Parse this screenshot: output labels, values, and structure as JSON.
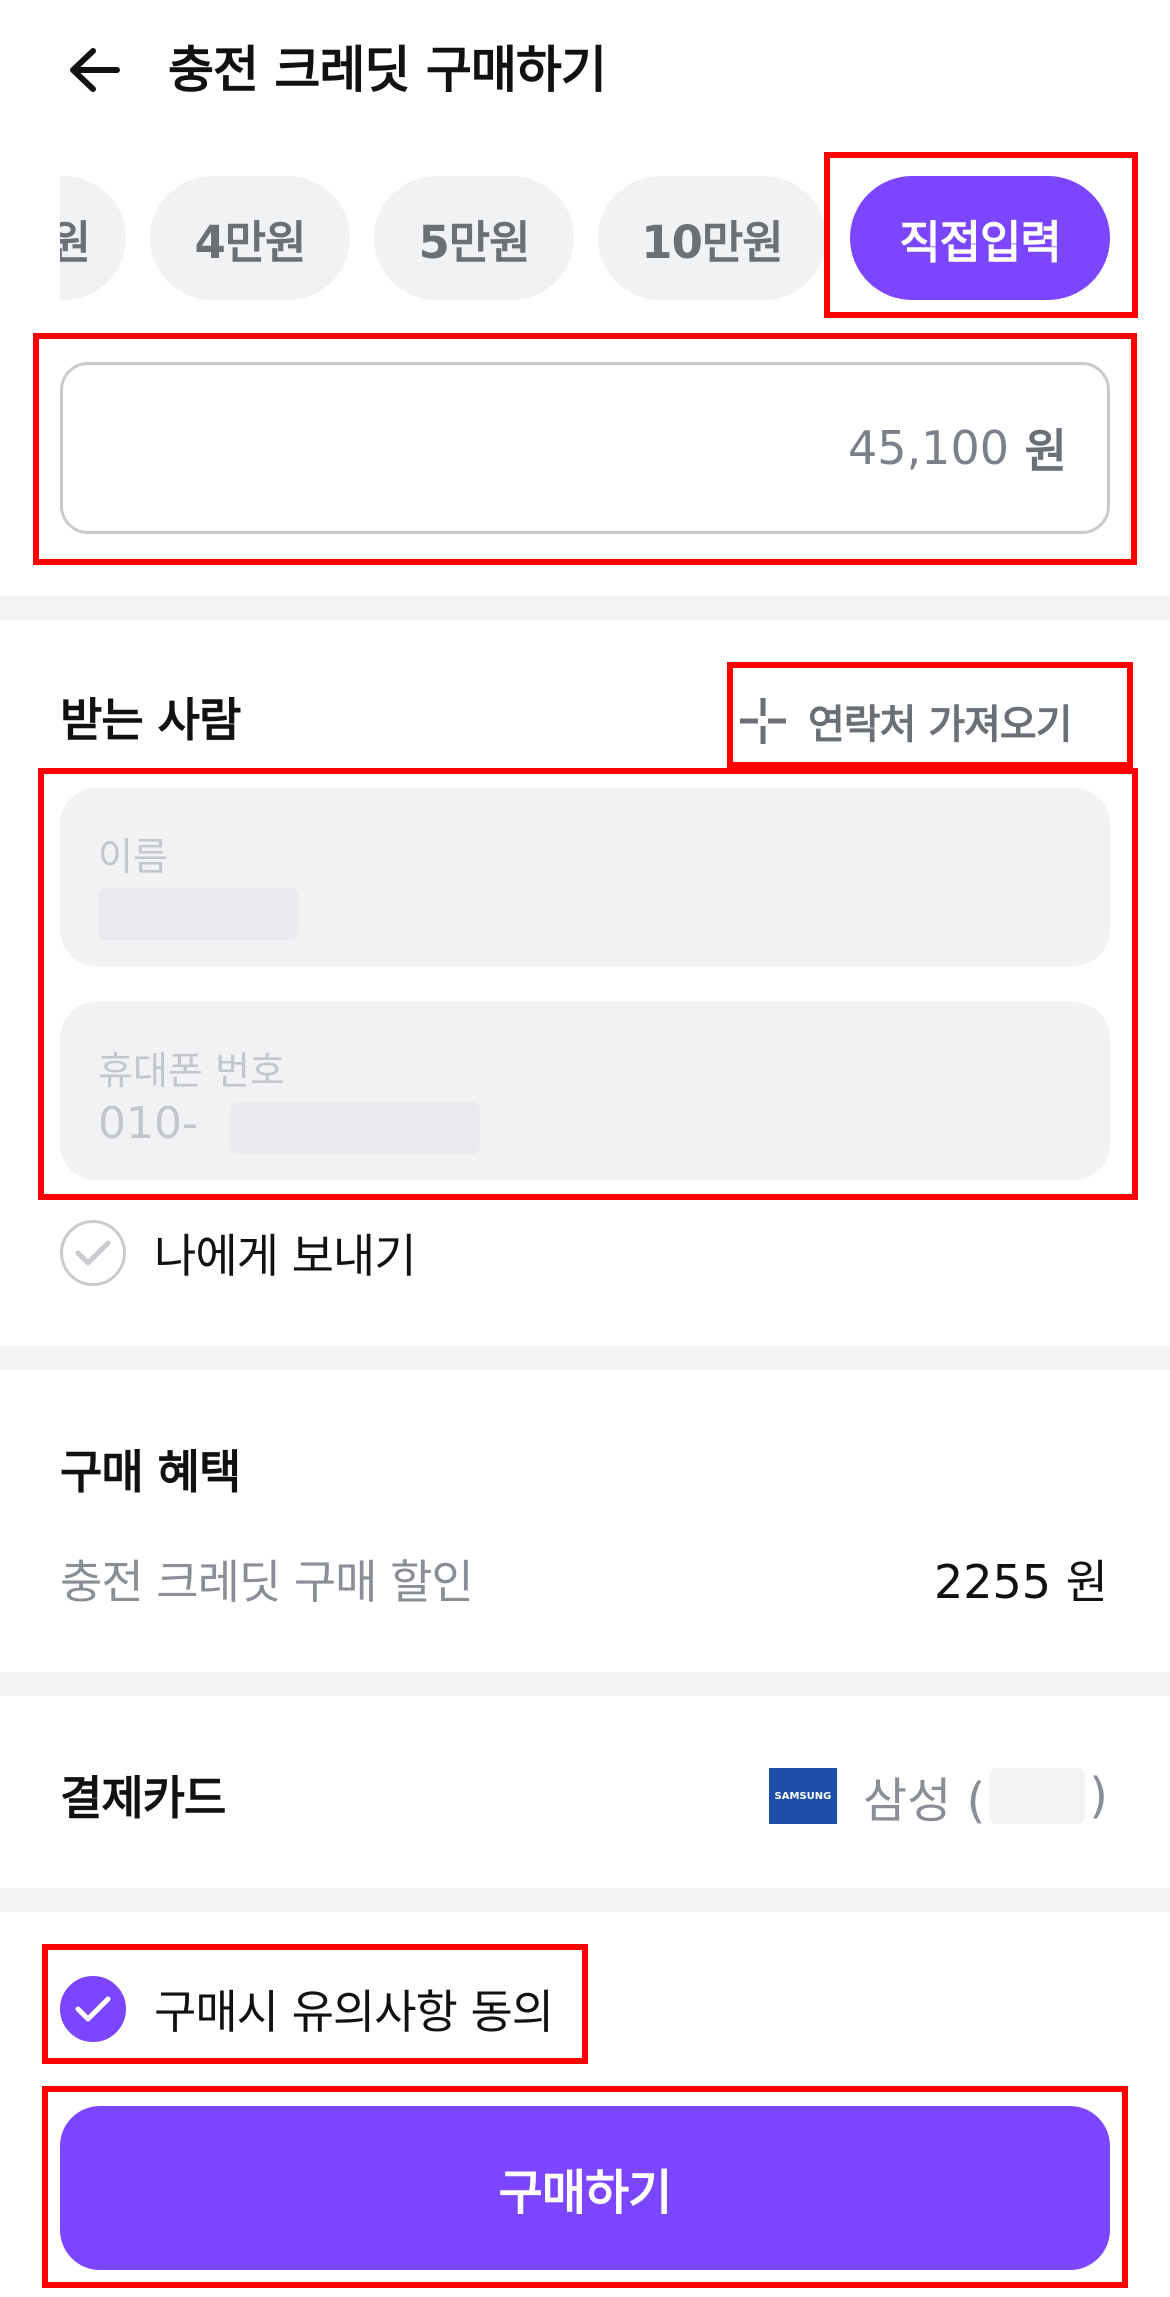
{
  "header": {
    "title": "충전 크레딧 구매하기",
    "back_icon": "arrow-left-icon"
  },
  "chips": [
    {
      "label": "원",
      "partial": true
    },
    {
      "label": "4만원"
    },
    {
      "label": "5만원"
    },
    {
      "label": "10만원"
    },
    {
      "label": "직접입력",
      "selected": true
    }
  ],
  "amount": {
    "value": "45,100",
    "unit": "원"
  },
  "recipient": {
    "title": "받는 사람",
    "import_contacts": {
      "label": "연락처 가져오기",
      "icon": "plus-icon"
    },
    "name_field": {
      "label": "이름"
    },
    "phone_field": {
      "label": "휴대폰 번호",
      "value_prefix": "010-"
    },
    "send_to_me": {
      "label": "나에게 보내기",
      "checked": false
    }
  },
  "benefits": {
    "title": "구매 혜택",
    "label": "충전 크레딧 구매 할인",
    "value": "2255 원"
  },
  "payment": {
    "title": "결제카드",
    "card_logo_text": "SAMSUNG",
    "card_name": "삼성 (",
    "card_suffix": ")"
  },
  "agreement": {
    "label": "구매시 유의사항 동의",
    "checked": true
  },
  "buy_button": {
    "label": "구매하기"
  },
  "colors": {
    "accent": "#7c45ff",
    "chip_bg": "#f1f2f4",
    "highlight": "#ff0000"
  }
}
